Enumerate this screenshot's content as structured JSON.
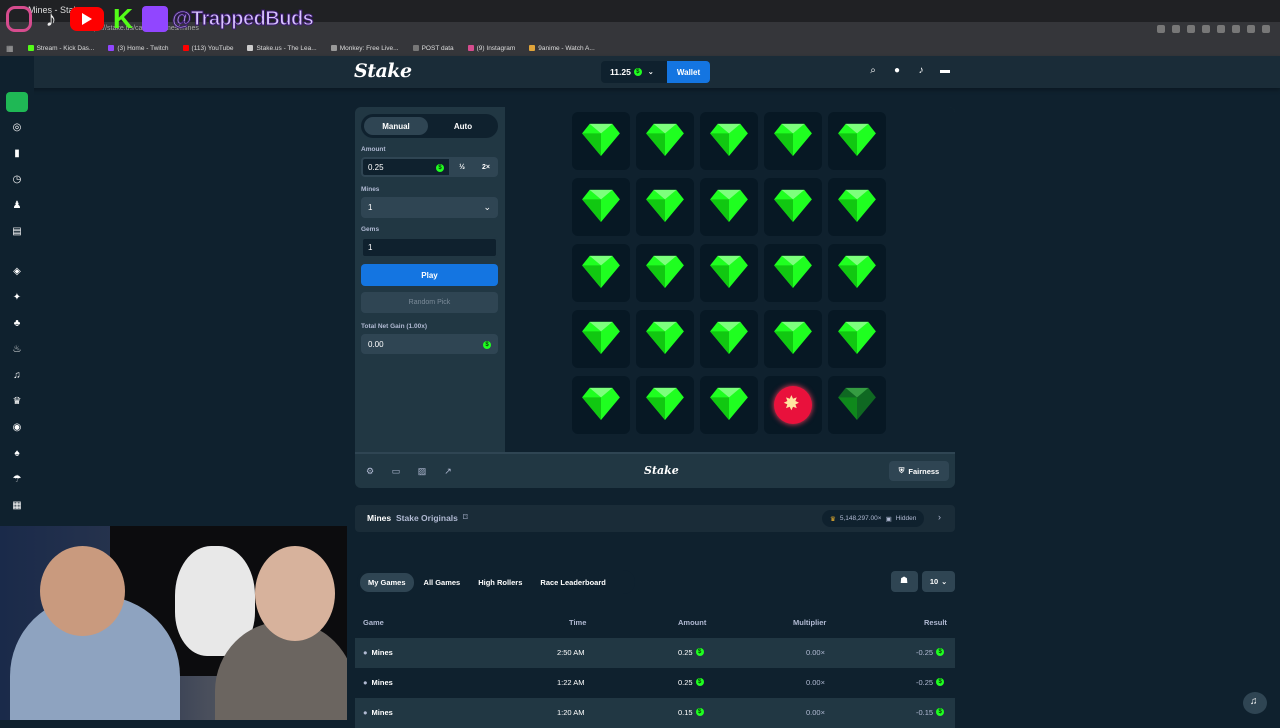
{
  "overlay": {
    "handle": "@TrappedBuds"
  },
  "browser": {
    "tab_title": "Mines - Stake...",
    "url": "https://stake.us/casino/games/mines",
    "bookmarks": [
      "Stream - Kick Das...",
      "(3) Home - Twitch",
      "(113) YouTube",
      "Stake.us - The Lea...",
      "Monkey: Free Live...",
      "POST data",
      "(9) Instagram",
      "9anime - Watch A..."
    ]
  },
  "header": {
    "logo": "Stake",
    "balance": "11.25",
    "wallet": "Wallet"
  },
  "game": {
    "mode_manual": "Manual",
    "mode_auto": "Auto",
    "amount_label": "Amount",
    "amount_value": "0.25",
    "half": "½",
    "double": "2×",
    "mines_label": "Mines",
    "mines_value": "1",
    "gems_label": "Gems",
    "gems_value": "1",
    "play": "Play",
    "random_pick": "Random Pick",
    "net_gain_label": "Total Net Gain (1.00x)",
    "net_gain_value": "0.00",
    "grid": [
      [
        "gem",
        "gem",
        "gem",
        "gem",
        "gem"
      ],
      [
        "gem",
        "gem",
        "gem",
        "gem",
        "gem"
      ],
      [
        "gem",
        "gem",
        "gem",
        "gem",
        "gem"
      ],
      [
        "gem",
        "gem",
        "gem",
        "gem",
        "gem"
      ],
      [
        "gem",
        "gem",
        "gem",
        "mine",
        "gem-dim"
      ]
    ]
  },
  "footer_bar": {
    "logo": "Stake",
    "fairness": "Fairness"
  },
  "info": {
    "title": "Mines",
    "subtitle": "Stake Originals",
    "stat": "5,148,297.00×",
    "stat_state": "Hidden"
  },
  "history": {
    "tabs": [
      "My Games",
      "All Games",
      "High Rollers",
      "Race Leaderboard"
    ],
    "count": "10",
    "columns": [
      "Game",
      "Time",
      "Amount",
      "Multiplier",
      "Result"
    ],
    "rows": [
      {
        "game": "Mines",
        "time": "2:50 AM",
        "amount": "0.25",
        "multiplier": "0.00×",
        "result": "-0.25"
      },
      {
        "game": "Mines",
        "time": "1:22 AM",
        "amount": "0.25",
        "multiplier": "0.00×",
        "result": "-0.25"
      },
      {
        "game": "Mines",
        "time": "1:20 AM",
        "amount": "0.15",
        "multiplier": "0.00×",
        "result": "-0.15"
      }
    ]
  },
  "colors": {
    "bg": "#0f212e",
    "panel": "#213743",
    "accent": "#1475e1",
    "gem": "#1fff20",
    "mine": "#e9113c"
  }
}
